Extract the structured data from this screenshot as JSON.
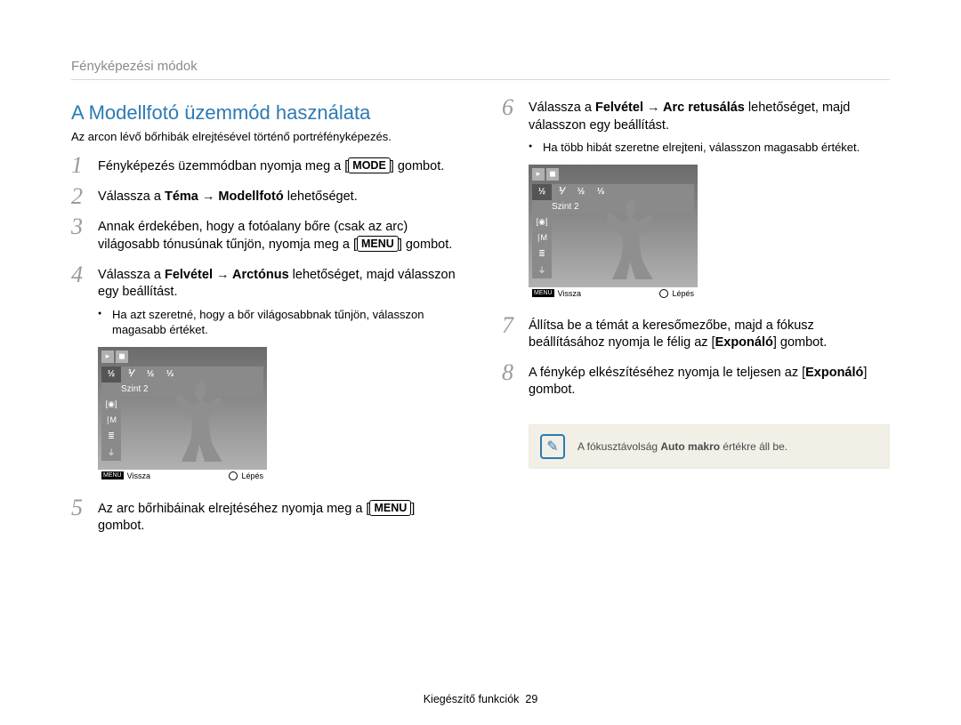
{
  "header": "Fényképezési módok",
  "section_title": "A Modellfotó üzemmód használata",
  "subtitle": "Az arcon lévő bőrhibák elrejtésével történő portréfényképezés.",
  "keycap_mode": "MODE",
  "keycap_menu": "MENU",
  "left": {
    "step1_a": "Fényképezés üzemmódban nyomja meg a [",
    "step1_b": "] gombot.",
    "step2_a": "Válassza a ",
    "step2_b": "Téma → Modellfotó",
    "step2_c": " lehetőséget.",
    "step3_a": "Annak érdekében, hogy a fotóalany bőre (csak az arc) világosabb tónusúnak tűnjön, nyomja meg a [",
    "step3_b": "] gombot.",
    "step4_a": "Válassza a ",
    "step4_b": "Felvétel → Arctónus",
    "step4_c": " lehetőséget, majd válasszon egy beállítást.",
    "step4_sub": "Ha azt szeretné, hogy a bőr világosabbnak tűnjön, válasszon magasabb értéket.",
    "step5_a": "Az arc bőrhibáinak elrejtéséhez nyomja meg a [",
    "step5_b": "] gombot."
  },
  "right": {
    "step6_a": "Válassza a ",
    "step6_b": "Felvétel → Arc retusálás",
    "step6_c": " lehetőséget, majd válasszon egy beállítást.",
    "step6_sub": "Ha több hibát szeretne elrejteni, válasszon magasabb értéket.",
    "step7_a": "Állítsa be a témát a keresőmezőbe, majd a fókusz beállításához nyomja le félig az [",
    "step7_b": "Exponáló",
    "step7_c": "] gombot.",
    "step8_a": "A fénykép elkészítéséhez nyomja le teljesen az [",
    "step8_b": "Exponáló",
    "step8_c": "] gombot."
  },
  "preview": {
    "level_label": "Szint 2",
    "menu": "MENU",
    "back": "Vissza",
    "step": "Lépés"
  },
  "note": {
    "icon_char": "✎",
    "text_a": "A fókusztávolság ",
    "text_b": "Auto makro",
    "text_c": " értékre áll be."
  },
  "footer": {
    "label": "Kiegészítő funkciók",
    "page": "29"
  },
  "nums": {
    "n1": "1",
    "n2": "2",
    "n3": "3",
    "n4": "4",
    "n5": "5",
    "n6": "6",
    "n7": "7",
    "n8": "8"
  }
}
